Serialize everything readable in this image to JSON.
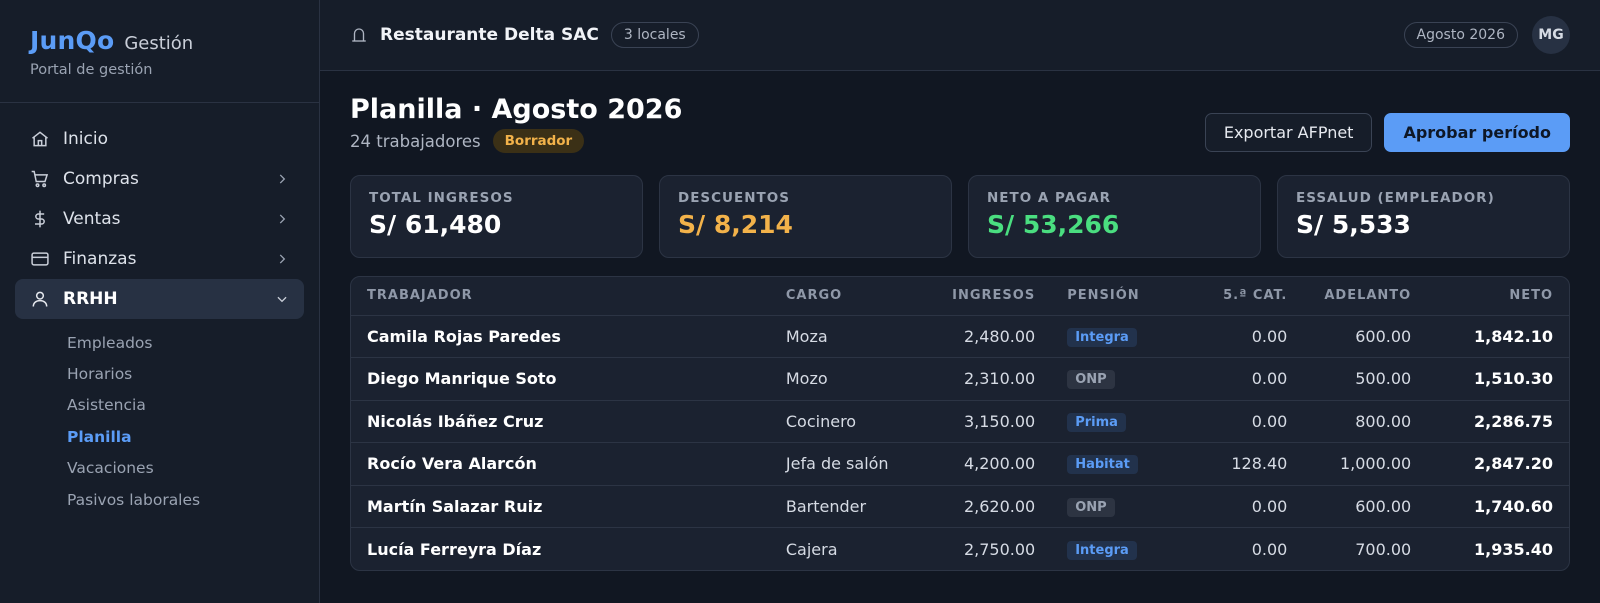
{
  "brand": {
    "logo": "JunQo",
    "suffix": "Gestión",
    "subtitle": "Portal de gestión"
  },
  "nav": {
    "items": [
      {
        "label": "Inicio",
        "icon": "home-icon"
      },
      {
        "label": "Compras",
        "icon": "cart-icon"
      },
      {
        "label": "Ventas",
        "icon": "dollar-icon"
      },
      {
        "label": "Finanzas",
        "icon": "card-icon"
      },
      {
        "label": "RRHH",
        "icon": "user-icon"
      }
    ],
    "sub": [
      "Empleados",
      "Horarios",
      "Asistencia",
      "Planilla",
      "Vacaciones",
      "Pasivos laborales"
    ]
  },
  "topbar": {
    "company": "Restaurante Delta SAC",
    "locales": "3 locales",
    "period": "Agosto 2026",
    "avatar": "MG"
  },
  "page": {
    "title": "Planilla · Agosto 2026",
    "count": "24 trabajadores",
    "status": "Borrador",
    "export_label": "Exportar AFPnet",
    "approve_label": "Aprobar período"
  },
  "kpis": [
    {
      "label": "TOTAL INGRESOS",
      "value": "S/ 61,480",
      "color": "#ffffff"
    },
    {
      "label": "DESCUENTOS",
      "value": "S/ 8,214",
      "color": "#f2b24a"
    },
    {
      "label": "NETO A PAGAR",
      "value": "S/ 53,266",
      "color": "#4ade80"
    },
    {
      "label": "ESSALUD (EMPLEADOR)",
      "value": "S/ 5,533",
      "color": "#ffffff"
    }
  ],
  "table": {
    "headers": [
      "TRABAJADOR",
      "CARGO",
      "INGRESOS",
      "PENSIÓN",
      "5.ª CAT.",
      "ADELANTO",
      "NETO"
    ],
    "rows": [
      [
        "Camila Rojas Paredes",
        "Moza",
        "2,480.00",
        "Integra",
        "0.00",
        "600.00",
        "1,842.10"
      ],
      [
        "Diego Manrique Soto",
        "Mozo",
        "2,310.00",
        "ONP",
        "0.00",
        "500.00",
        "1,510.30"
      ],
      [
        "Nicolás Ibáñez Cruz",
        "Cocinero",
        "3,150.00",
        "Prima",
        "0.00",
        "800.00",
        "2,286.75"
      ],
      [
        "Rocío Vera Alarcón",
        "Jefa de salón",
        "4,200.00",
        "Habitat",
        "128.40",
        "1,000.00",
        "2,847.20"
      ],
      [
        "Martín Salazar Ruiz",
        "Bartender",
        "2,620.00",
        "ONP",
        "0.00",
        "600.00",
        "1,740.60"
      ],
      [
        "Lucía Ferreyra Díaz",
        "Cajera",
        "2,750.00",
        "Integra",
        "0.00",
        "700.00",
        "1,935.40"
      ]
    ]
  }
}
